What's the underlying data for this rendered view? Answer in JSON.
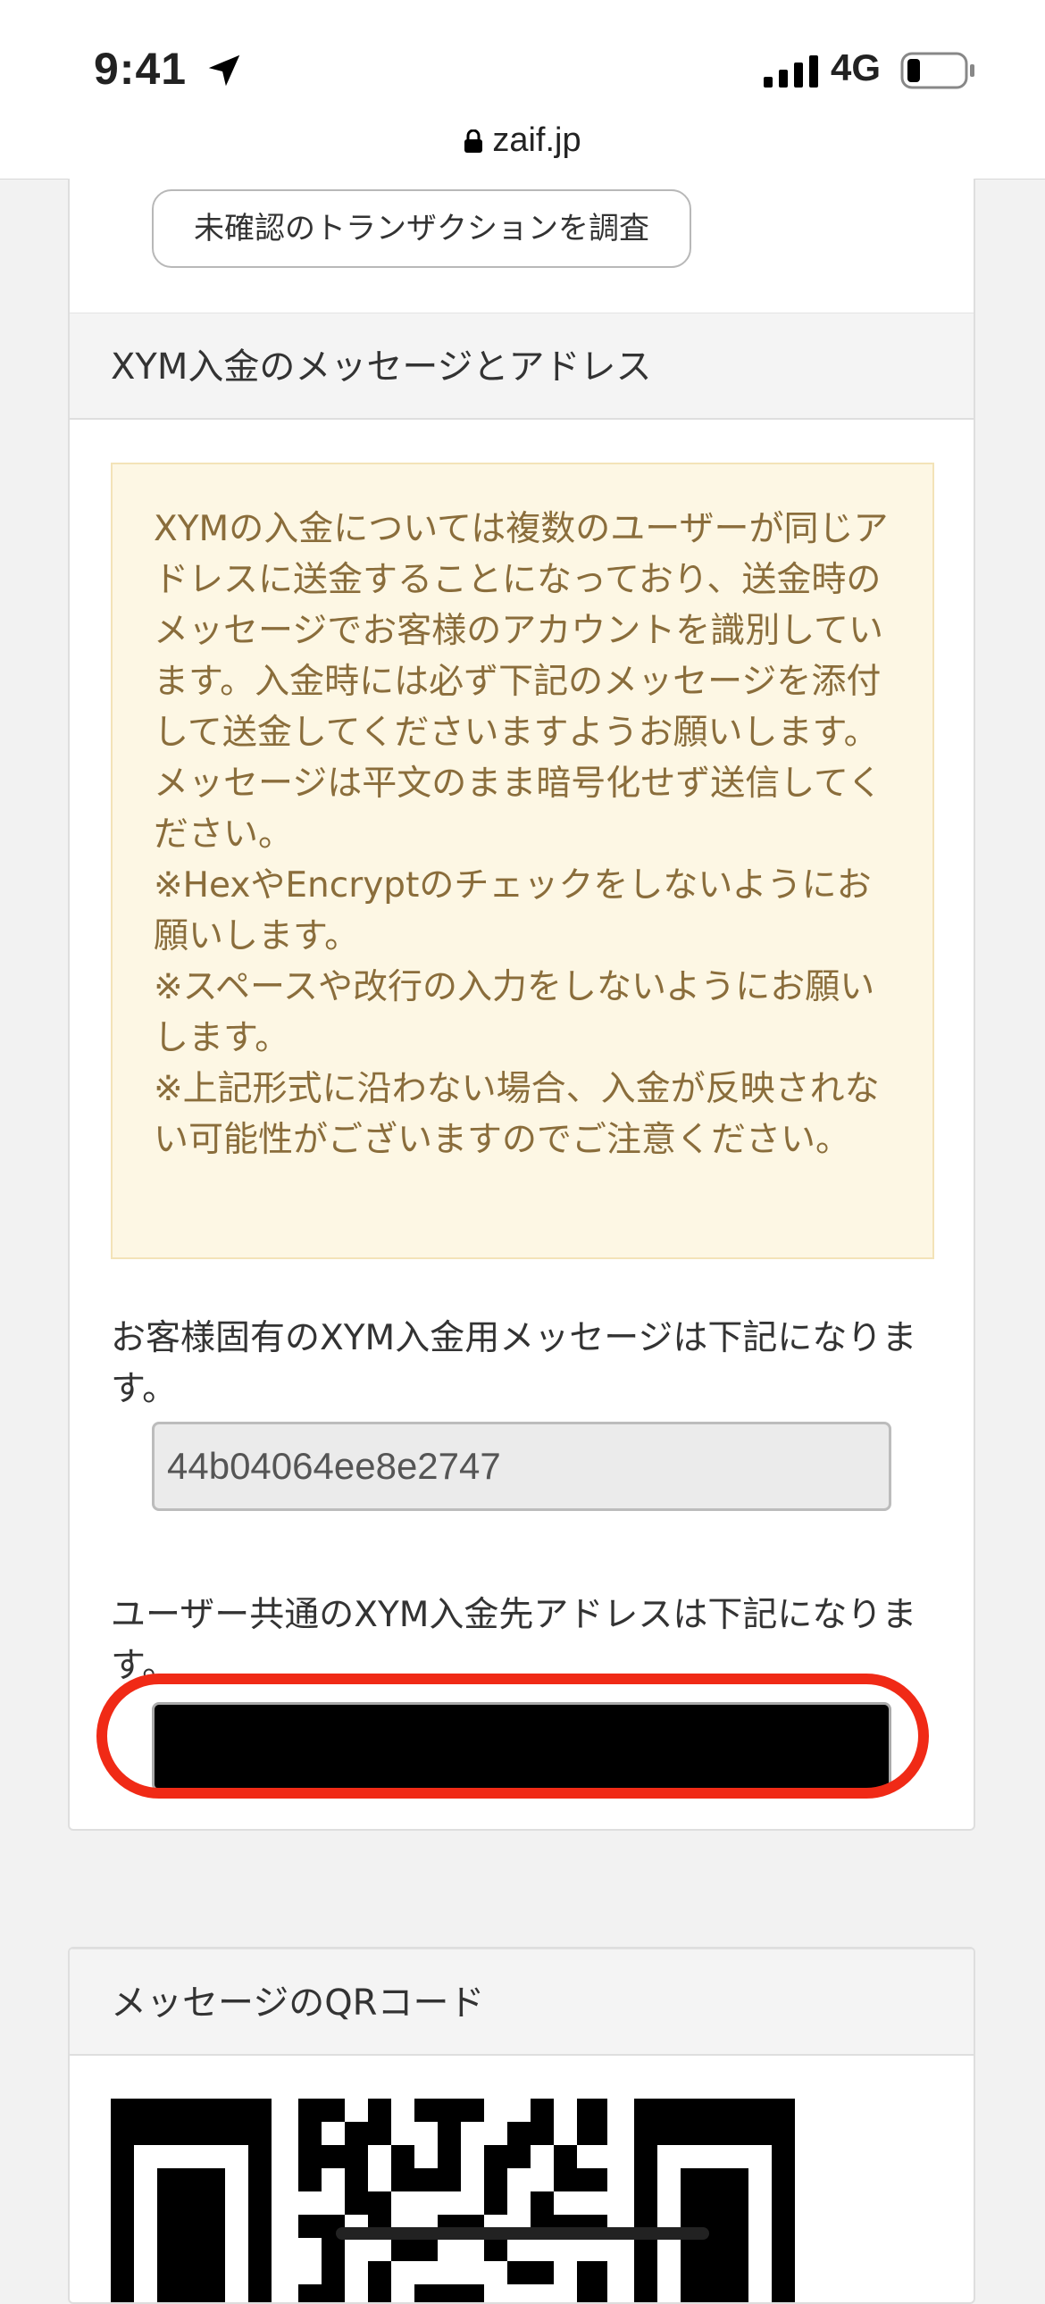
{
  "status_bar": {
    "time": "9:41",
    "network": "4G",
    "location_icon": "location-arrow-icon",
    "signal_icon": "cellular-signal-icon",
    "battery_icon": "battery-low-icon"
  },
  "browser": {
    "url": "zaif.jp",
    "lock_icon": "lock-icon"
  },
  "deposit_panel": {
    "check_button_label": "未確認のトランザクションを調査",
    "section_title": "XYM入金のメッセージとアドレス",
    "notice_text": "XYMの入金については複数のユーザーが同じアドレスに送金することになっており、送金時のメッセージでお客様のアカウントを識別しています。入金時には必ず下記のメッセージを添付して送金してくださいますようお願いします。メッセージは平文のまま暗号化せず送信してください。\n※HexやEncryptのチェックをしないようにお願いします。\n※スペースや改行の入力をしないようにお願いします。\n※上記形式に沿わない場合、入金が反映されない可能性がございますのでご注意ください。",
    "message_label": "お客様固有のXYM入金用メッセージは下記になります。",
    "message_value": "44b04064ee8e2747",
    "address_label": "ユーザー共通のXYM入金先アドレスは下記になります。",
    "address_value": ""
  },
  "qr_panel": {
    "section_title": "メッセージのQRコード"
  },
  "colors": {
    "notice_bg": "#fdf7e4",
    "notice_text": "#8a6d3b",
    "highlight": "#f02a16"
  }
}
